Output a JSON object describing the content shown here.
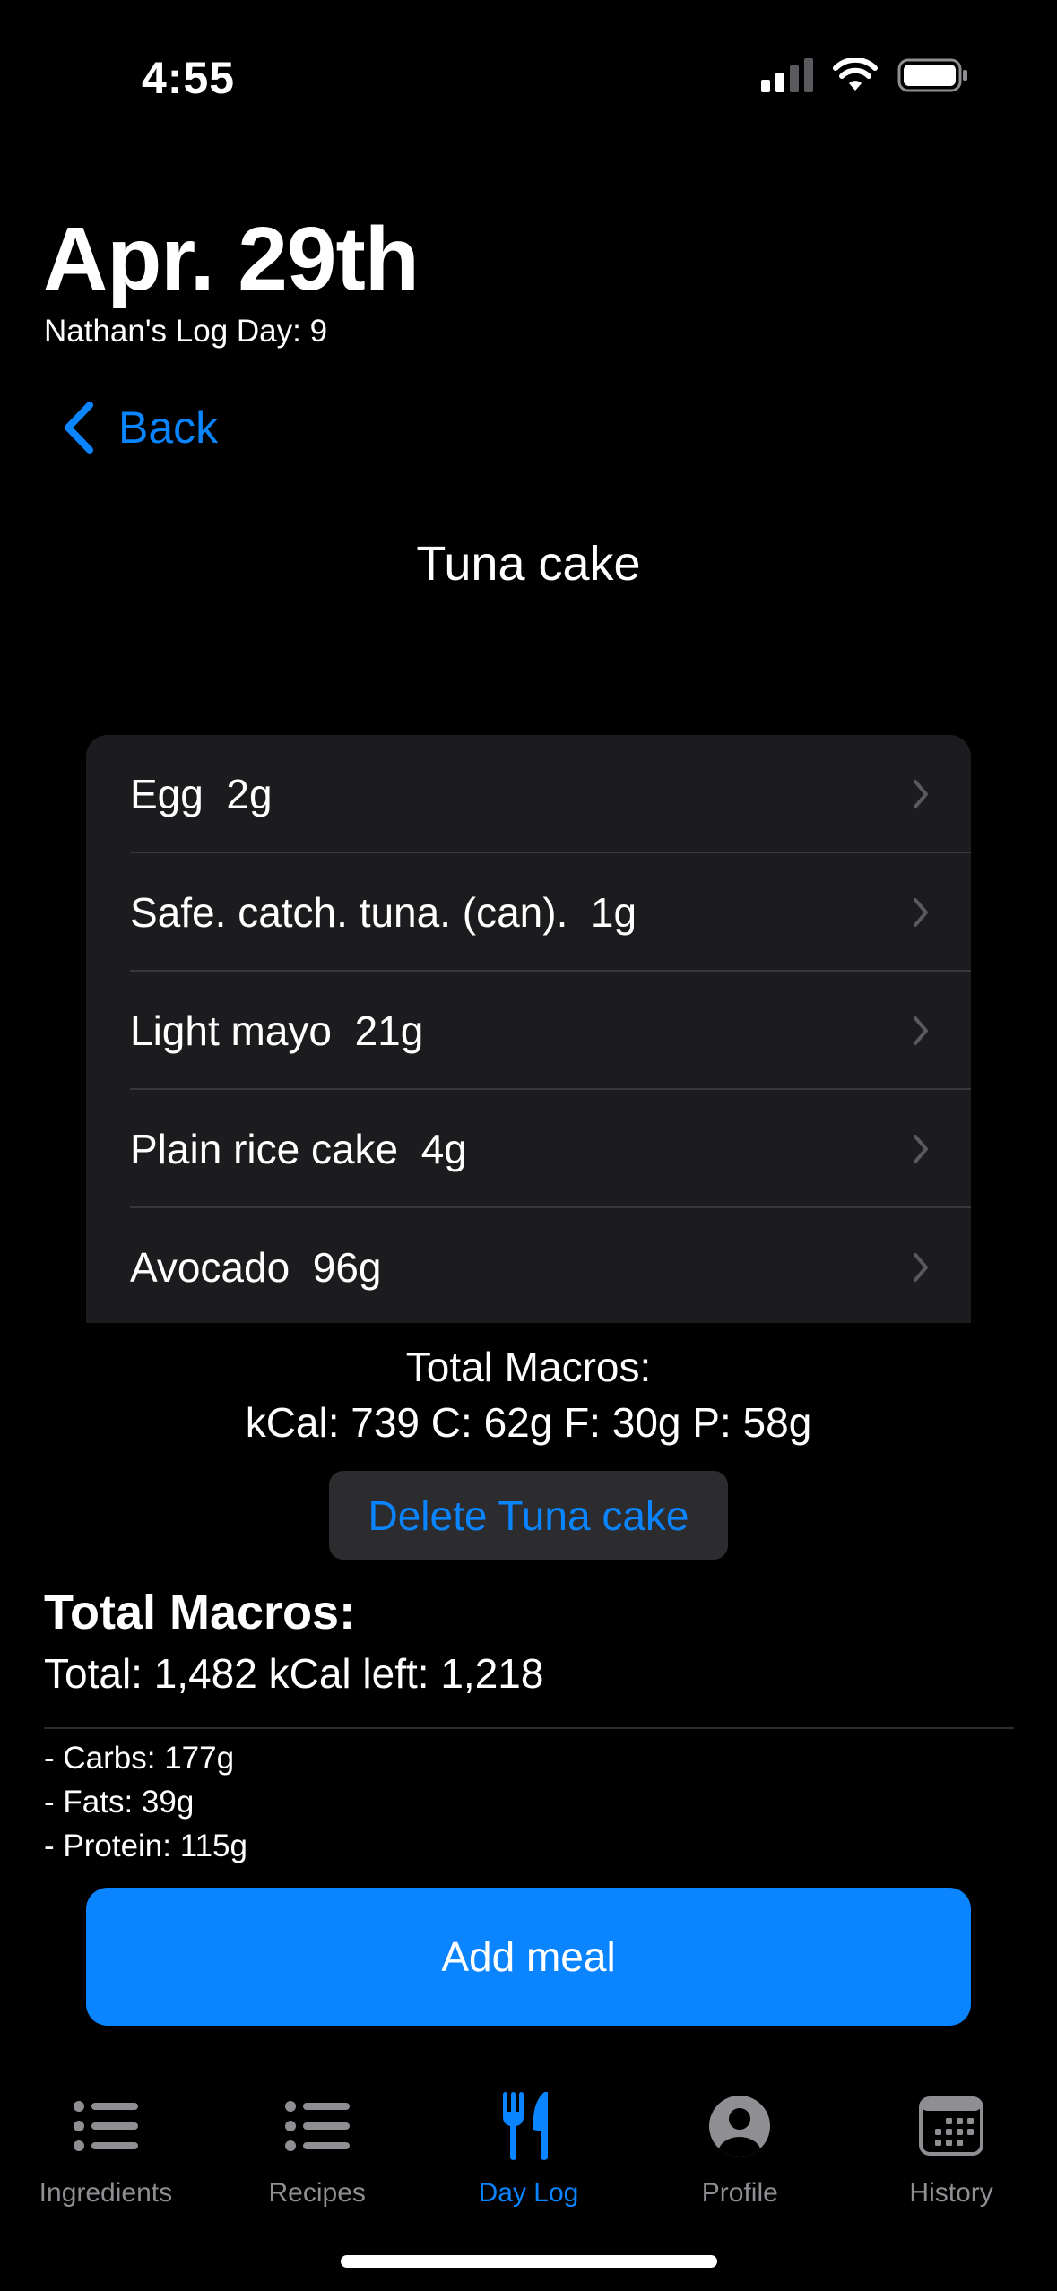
{
  "status_bar": {
    "time": "4:55"
  },
  "header": {
    "title": "Apr. 29th",
    "subtitle": "Nathan's Log Day: 9",
    "back_label": "Back"
  },
  "meal": {
    "title": "Tuna cake",
    "ingredients": [
      {
        "label": "Egg  2g"
      },
      {
        "label": "Safe. catch. tuna. (can).  1g"
      },
      {
        "label": "Light mayo  21g"
      },
      {
        "label": "Plain rice cake  4g"
      },
      {
        "label": "Avocado  96g"
      }
    ],
    "macros_heading": "Total Macros:",
    "macros_values": "kCal: 739 C: 62g F: 30g P: 58g",
    "delete_label": "Delete Tuna cake"
  },
  "day_totals": {
    "heading": "Total Macros:",
    "total_line": "Total: 1,482 kCal left: 1,218",
    "carbs": "- Carbs: 177g",
    "fats": "- Fats: 39g",
    "protein": "- Protein: 115g"
  },
  "add_meal_label": "Add meal",
  "tabs": [
    {
      "label": "Ingredients",
      "icon": "list-icon",
      "active": false
    },
    {
      "label": "Recipes",
      "icon": "list-icon",
      "active": false
    },
    {
      "label": "Day Log",
      "icon": "fork-knife-icon",
      "active": true
    },
    {
      "label": "Profile",
      "icon": "person-circle-icon",
      "active": false
    },
    {
      "label": "History",
      "icon": "calendar-icon",
      "active": false
    }
  ],
  "colors": {
    "accent": "#0a84ff",
    "background": "#000000",
    "card": "#1c1c1e",
    "inactive_tab": "#8e8e93"
  }
}
